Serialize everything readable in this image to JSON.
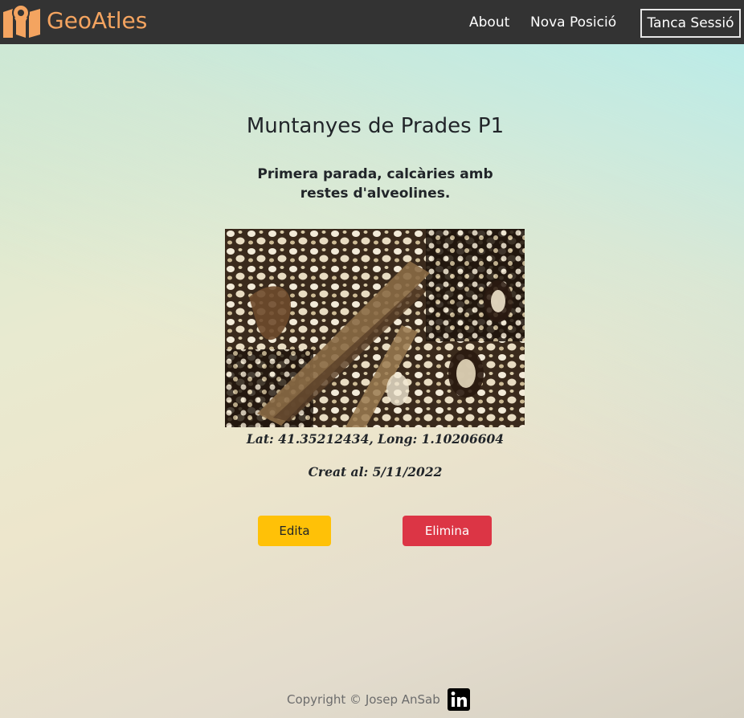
{
  "navbar": {
    "brand": "GeoAtles",
    "links": {
      "about": "About",
      "new_position": "Nova Posició",
      "logout": "Tanca Sessió"
    },
    "brand_color": "#f4a460",
    "background": "#333333"
  },
  "position": {
    "title": "Muntanyes de Prades P1",
    "description": "Primera parada, calcàries amb restes d'alveolines.",
    "coordinates": "Lat: 41.35212434, Long: 1.10206604",
    "created": "Creat al: 5/11/2022"
  },
  "actions": {
    "edit_label": "Edita",
    "delete_label": "Elimina",
    "edit_color": "#ffc107",
    "delete_color": "#dc3545"
  },
  "footer": {
    "copyright": "Copyright © Josep AnSab",
    "social_icon": "linkedin-icon"
  }
}
